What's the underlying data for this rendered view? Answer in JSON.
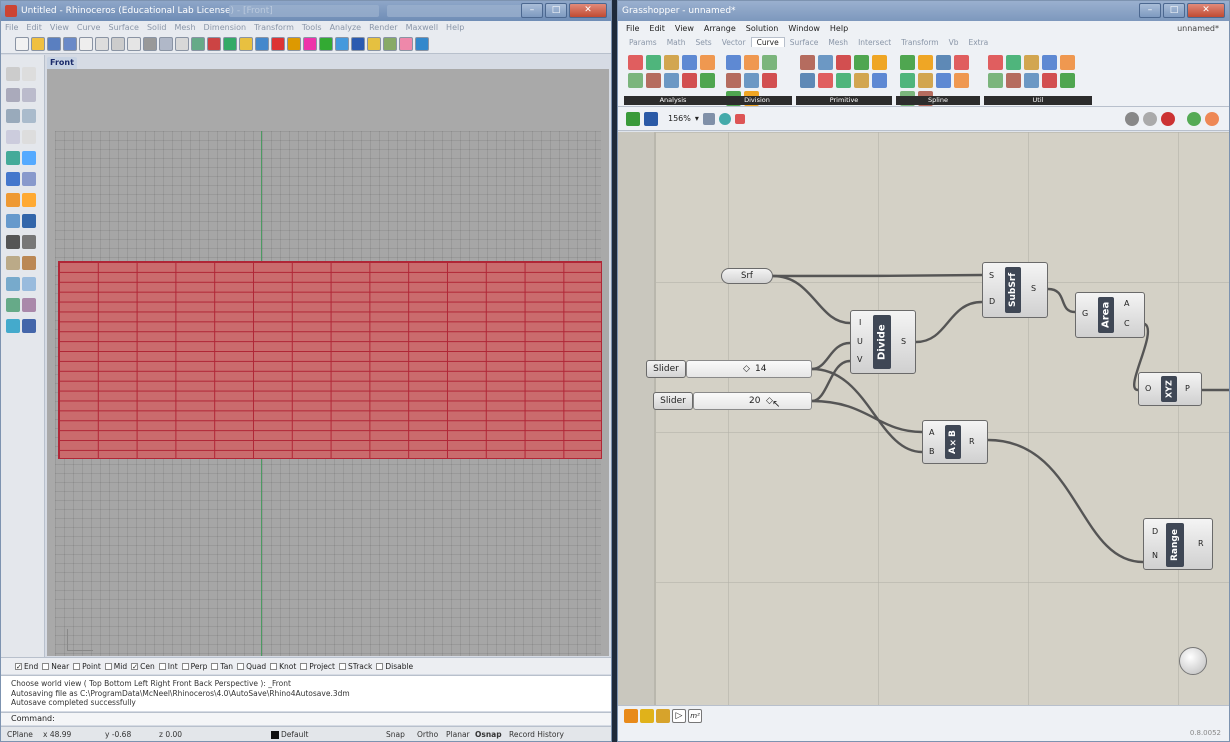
{
  "rhino": {
    "title": "Untitled - Rhinoceros (Educational Lab License) - [Front]",
    "window_buttons": {
      "min": "–",
      "max": "□",
      "close": "✕"
    },
    "menu": [
      "File",
      "Edit",
      "View",
      "Curve",
      "Surface",
      "Solid",
      "Mesh",
      "Dimension",
      "Transform",
      "Tools",
      "Analyze",
      "Render",
      "Maxwell",
      "Help"
    ],
    "viewport_label": "Front",
    "osnap": [
      "End",
      "Near",
      "Point",
      "Mid",
      "Cen",
      "Int",
      "Perp",
      "Tan",
      "Quad",
      "Knot",
      "Project",
      "STrack",
      "Disable"
    ],
    "osnap_checked": [
      "End",
      "Cen"
    ],
    "history": [
      "Choose world view ( Top  Bottom  Left  Right  Front  Back  Perspective ): _Front",
      "Autosaving file as C:\\ProgramData\\McNeel\\Rhinoceros\\4.0\\AutoSave\\Rhino4Autosave.3dm",
      "Autosave completed successfully"
    ],
    "command_label": "Command:",
    "status": {
      "cplane": "CPlane",
      "x": "x 48.99",
      "y": "y -0.68",
      "z": "z 0.00",
      "layer": "Default",
      "snap": "Snap",
      "ortho": "Ortho",
      "planar": "Planar",
      "osnap": "Osnap",
      "record": "Record History"
    }
  },
  "gh": {
    "title": "Grasshopper - unnamed*",
    "document_name": "unnamed*",
    "menu": [
      "File",
      "Edit",
      "View",
      "Arrange",
      "Solution",
      "Window",
      "Help"
    ],
    "tabs": [
      "Params",
      "Math",
      "Sets",
      "Vector",
      "Curve",
      "Surface",
      "Mesh",
      "Intersect",
      "Transform",
      "Vb",
      "Extra"
    ],
    "active_tab": "Curve",
    "ribbon_groups": [
      "Analysis",
      "Division",
      "Primitive",
      "Spline",
      "Util"
    ],
    "zoom": "156%",
    "components": {
      "srf": "Srf",
      "subsrf": {
        "name": "SubSrf",
        "inputs": [
          "S",
          "D"
        ],
        "outputs": [
          "S"
        ]
      },
      "divide": {
        "name": "Divide",
        "inputs": [
          "I",
          "U",
          "V"
        ],
        "outputs": [
          "S"
        ]
      },
      "area": {
        "name": "Area",
        "inputs": [
          "G"
        ],
        "outputs": [
          "A",
          "C"
        ]
      },
      "xyz": {
        "name": "XYZ",
        "inputs": [
          "O"
        ],
        "outputs": [
          "P"
        ]
      },
      "mult": {
        "name": "A×B",
        "inputs": [
          "A",
          "B"
        ],
        "outputs": [
          "R"
        ]
      },
      "range": {
        "name": "Range",
        "inputs": [
          "D",
          "N"
        ],
        "outputs": [
          "R"
        ]
      }
    },
    "sliders": [
      {
        "label": "Slider",
        "value": "14"
      },
      {
        "label": "Slider",
        "value": "20"
      }
    ],
    "version": "0.8.0052"
  }
}
